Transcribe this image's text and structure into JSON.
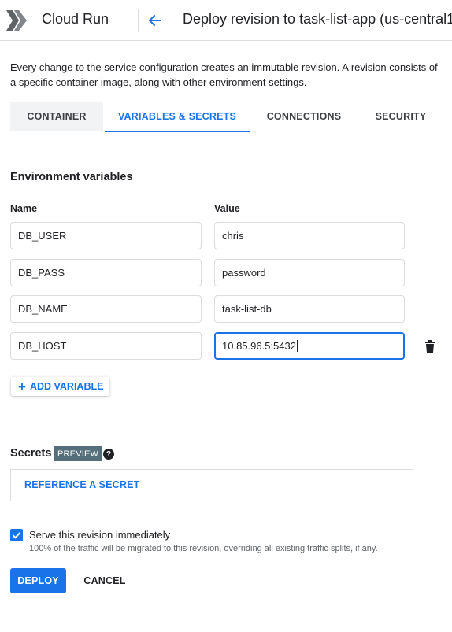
{
  "header": {
    "product": "Cloud Run",
    "title": "Deploy revision to task-list-app (us-central1"
  },
  "intro": "Every change to the service configuration creates an immutable revision. A revision consists of a specific container image, along with other environment settings.",
  "tabs": [
    {
      "label": "CONTAINER",
      "active": false
    },
    {
      "label": "VARIABLES & SECRETS",
      "active": true
    },
    {
      "label": "CONNECTIONS",
      "active": false
    },
    {
      "label": "SECURITY",
      "active": false
    }
  ],
  "env": {
    "title": "Environment variables",
    "name_label": "Name",
    "value_label": "Value",
    "rows": [
      {
        "name": "DB_USER",
        "value": "chris"
      },
      {
        "name": "DB_PASS",
        "value": "password"
      },
      {
        "name": "DB_NAME",
        "value": "task-list-db"
      },
      {
        "name": "DB_HOST",
        "value": "10.85.96.5:5432"
      }
    ],
    "add_label": "ADD VARIABLE"
  },
  "secrets": {
    "title": "Secrets",
    "badge": "PREVIEW",
    "reference_label": "REFERENCE A SECRET"
  },
  "serve": {
    "checked": true,
    "label": "Serve this revision immediately",
    "help": "100% of the traffic will be migrated to this revision, overriding all existing traffic splits, if any."
  },
  "actions": {
    "deploy": "DEPLOY",
    "cancel": "CANCEL"
  },
  "colors": {
    "accent": "#1a73e8",
    "badge": "#546e7a",
    "border": "#dadce0"
  }
}
